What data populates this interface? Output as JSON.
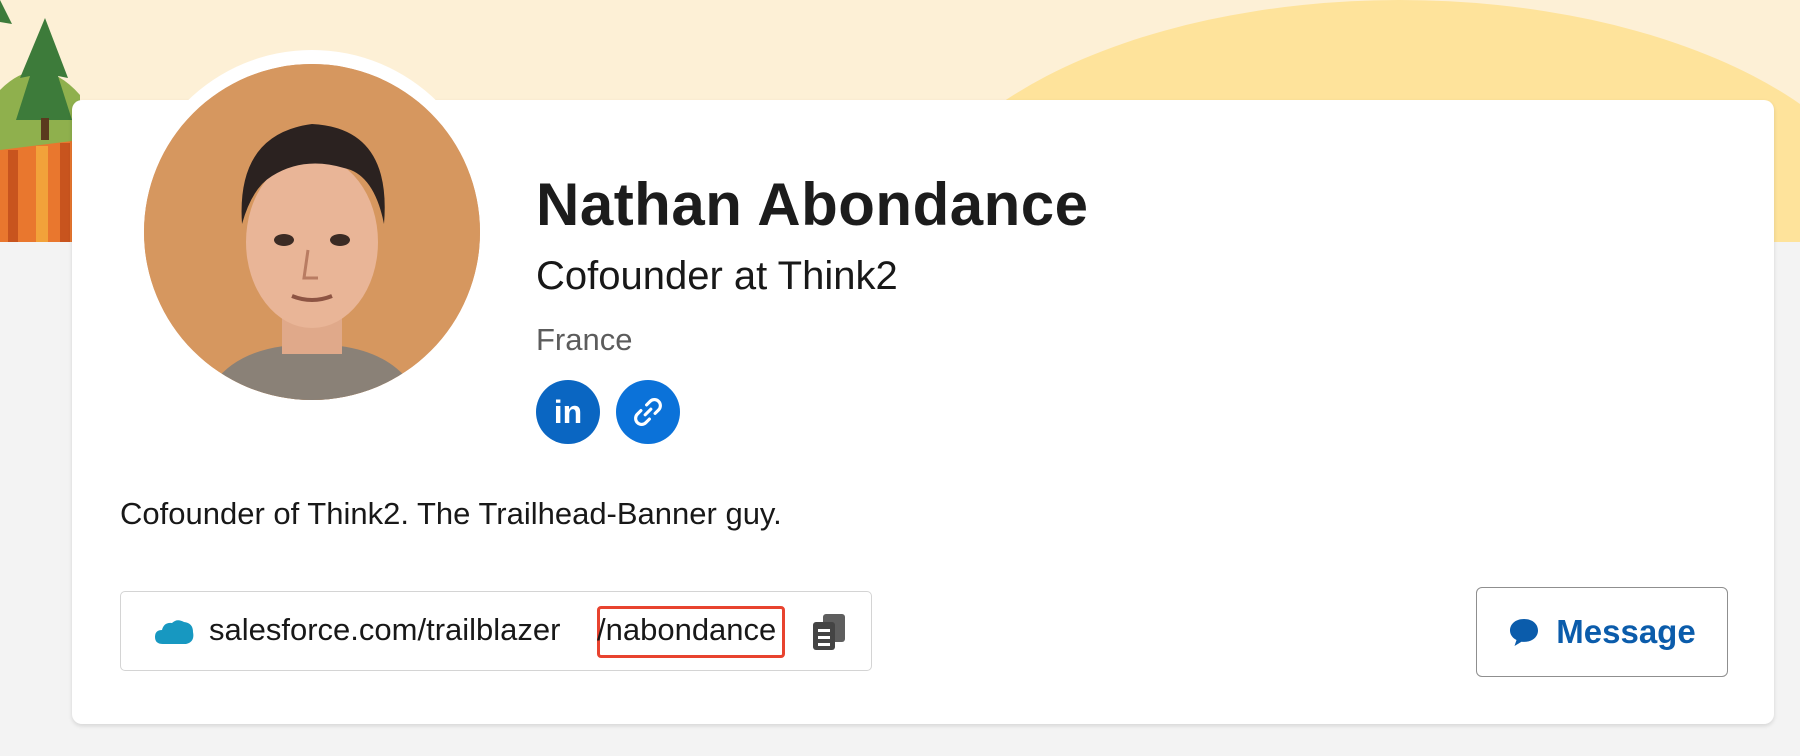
{
  "profile": {
    "name": "Nathan Abondance",
    "title": "Cofounder at Think2",
    "location": "France",
    "bio": "Cofounder of Think2. The Trailhead-Banner guy."
  },
  "social": {
    "linkedin_label": "in"
  },
  "profile_url": {
    "base": "salesforce.com/trailblazer",
    "handle": "/nabondance"
  },
  "actions": {
    "message_label": "Message"
  },
  "colors": {
    "brand_blue": "#0b72d9",
    "linkedin_blue": "#0a66c2",
    "message_text": "#0b5cab",
    "highlight_red": "#e8432f",
    "banner_light": "#fdf0d6",
    "banner_hill": "#fee39b"
  },
  "icons": [
    "linkedin-icon",
    "link-icon",
    "salesforce-cloud-icon",
    "copy-icon",
    "chat-bubble-icon"
  ]
}
